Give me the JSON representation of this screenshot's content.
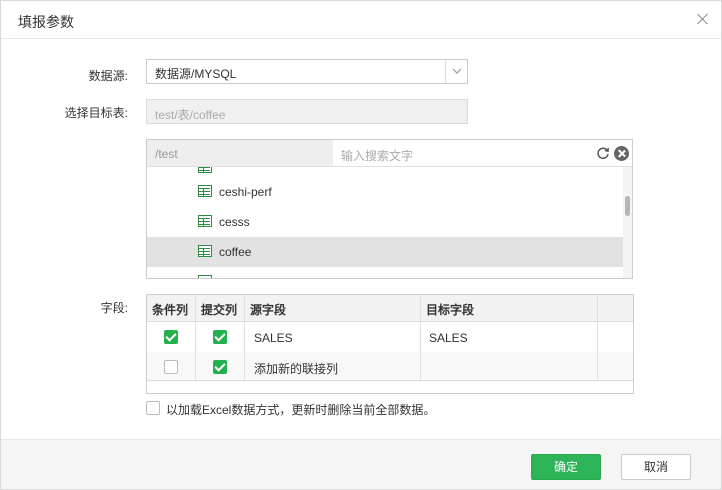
{
  "dialog": {
    "title": "填报参数"
  },
  "form": {
    "datasource_label": "数据源:",
    "datasource_value": "数据源/MYSQL",
    "target_label": "选择目标表:",
    "target_value": "test/表/coffee",
    "fields_label": "字段:"
  },
  "tree": {
    "path": "/test",
    "search_placeholder": "输入搜索文字",
    "items": [
      {
        "label": "ceshi-perf",
        "selected": false
      },
      {
        "label": "cesss",
        "selected": false
      },
      {
        "label": "coffee",
        "selected": true
      }
    ]
  },
  "table": {
    "headers": [
      "条件列",
      "提交列",
      "源字段",
      "目标字段"
    ],
    "rows": [
      {
        "condition": true,
        "submit": true,
        "source": "SALES",
        "target": "SALES"
      },
      {
        "condition": false,
        "submit": true,
        "source": "添加新的联接列",
        "target": ""
      }
    ]
  },
  "excel_option": {
    "label": "以加载Excel数据方式，更新时删除当前全部数据。",
    "checked": false
  },
  "buttons": {
    "confirm": "确定",
    "cancel": "取消"
  },
  "colors": {
    "primary": "#2db456",
    "checkbox": "#22b14c",
    "table_icon": "#2e8b3f"
  }
}
